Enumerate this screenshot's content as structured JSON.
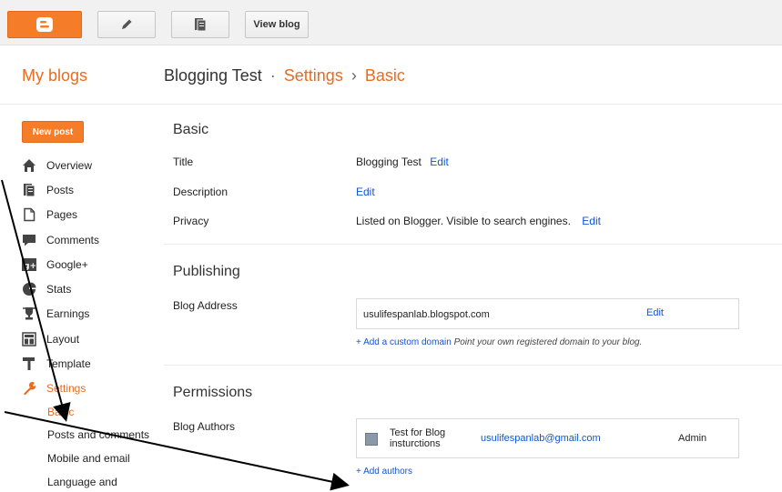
{
  "toolbar": {
    "view_blog_label": "View blog"
  },
  "header": {
    "my_blogs": "My blogs",
    "blog_name": "Blogging Test",
    "sep1": "·",
    "section": "Settings",
    "sep2": "›",
    "page": "Basic"
  },
  "sidebar": {
    "new_post_label": "New post",
    "items": [
      {
        "label": "Overview",
        "icon": "home-icon"
      },
      {
        "label": "Posts",
        "icon": "posts-icon"
      },
      {
        "label": "Pages",
        "icon": "page-icon"
      },
      {
        "label": "Comments",
        "icon": "comment-icon"
      },
      {
        "label": "Google+",
        "icon": "google-plus-icon"
      },
      {
        "label": "Stats",
        "icon": "pie-chart-icon"
      },
      {
        "label": "Earnings",
        "icon": "trophy-icon"
      },
      {
        "label": "Layout",
        "icon": "layout-icon"
      },
      {
        "label": "Template",
        "icon": "paint-roller-icon"
      },
      {
        "label": "Settings",
        "icon": "wrench-icon"
      }
    ],
    "settings_sub": [
      "Basic",
      "Posts and comments",
      "Mobile and email",
      "Language and"
    ]
  },
  "basic": {
    "heading": "Basic",
    "title_label": "Title",
    "title_value": "Blogging Test",
    "description_label": "Description",
    "privacy_label": "Privacy",
    "privacy_value": "Listed on Blogger. Visible to search engines.",
    "edit_label": "Edit"
  },
  "publishing": {
    "heading": "Publishing",
    "address_label": "Blog Address",
    "address_value": "usulifespanlab.blogspot.com",
    "add_domain_link": "+ Add a custom domain",
    "add_domain_hint": "Point your own registered domain to your blog."
  },
  "permissions": {
    "heading": "Permissions",
    "authors_label": "Blog Authors",
    "author_name": "Test for Blog insturctions",
    "author_email": "usulifespanlab@gmail.com",
    "author_role": "Admin",
    "add_authors": "+ Add authors"
  },
  "colors": {
    "accent": "#f57d2a",
    "link": "#1155cc"
  }
}
